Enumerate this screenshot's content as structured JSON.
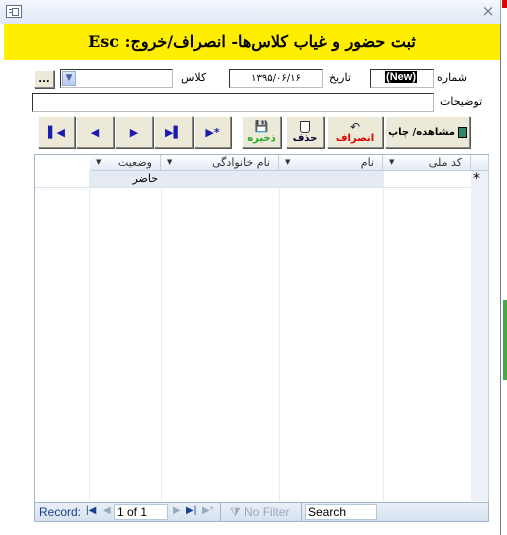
{
  "window": {
    "close_icon": "×"
  },
  "banner": {
    "title": "ثبت حضور و غیاب کلاس‌ها- انصراف/خروج: Esc",
    "color": "#ffee00"
  },
  "form": {
    "number_label": "شماره",
    "number_value": "(New)",
    "date_label": "تاریخ",
    "date_value": "۱۳۹۵/۰۶/۱۶",
    "class_label": "کلاس",
    "class_value": "",
    "browse_label": "...",
    "notes_label": "توضیحات",
    "notes_value": ""
  },
  "toolbar": {
    "print_label": "مشاهده/ چاپ",
    "undo_label": "انصراف",
    "delete_label": "حذف",
    "save_label": "ذخیره",
    "new_record": "▶*",
    "last": "▶▌",
    "next": "▶",
    "prev": "◀",
    "first": "▌◀"
  },
  "datasheet": {
    "columns": [
      "کد ملی",
      "نام",
      "نام خانوادگی",
      "وضعیت"
    ],
    "new_row_marker": "*",
    "new_row": {
      "national_id": "",
      "first_name": "",
      "last_name": "",
      "status": "حاضر"
    }
  },
  "record_nav": {
    "label": "Record:",
    "position": "1 of 1",
    "filter": "No Filter",
    "search": "Search"
  }
}
